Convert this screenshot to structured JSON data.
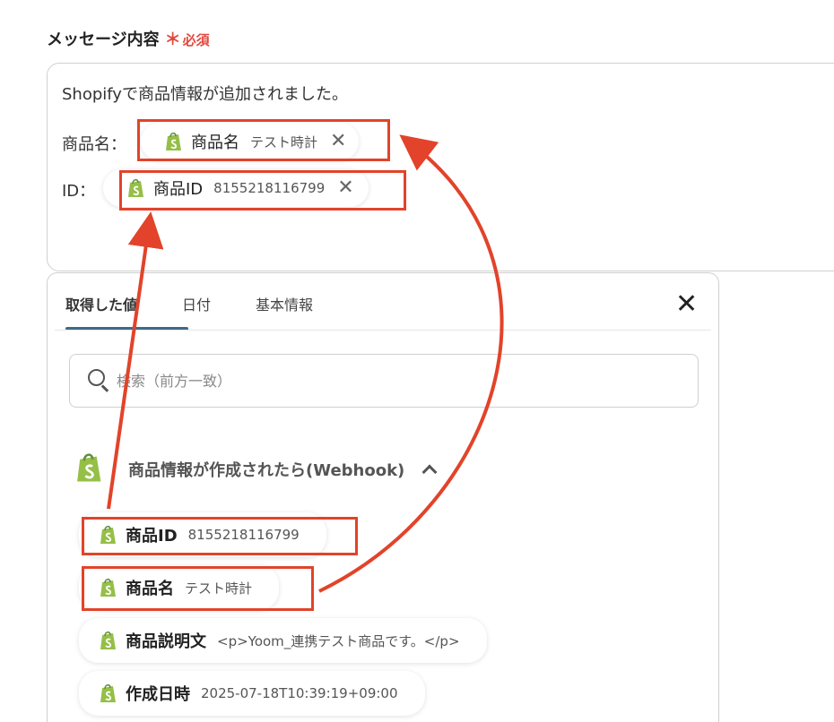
{
  "field": {
    "label": "メッセージ内容",
    "required_star": "＊",
    "required_text": "必須"
  },
  "message": {
    "line1": "Shopifyで商品情報が追加されました。",
    "line2_prefix": "商品名：",
    "line3_prefix": "ID："
  },
  "inserted_chips": [
    {
      "name": "商品名",
      "value": "テスト時計"
    },
    {
      "name": "商品ID",
      "value": "8155218116799"
    }
  ],
  "popup": {
    "tabs": [
      {
        "label": "取得した値",
        "active": true
      },
      {
        "label": "日付",
        "active": false
      },
      {
        "label": "基本情報",
        "active": false
      }
    ],
    "search_placeholder": "検索（前方一致）",
    "group_title": "商品情報が作成されたら(Webhook)",
    "items": [
      {
        "name": "商品ID",
        "value": "8155218116799"
      },
      {
        "name": "商品名",
        "value": "テスト時計"
      },
      {
        "name": "商品説明文",
        "value": "<p>Yoom_連携テスト商品です。</p>"
      },
      {
        "name": "作成日時",
        "value": "2025-07-18T10:39:19+09:00"
      }
    ]
  },
  "colors": {
    "required": "#e2483d",
    "highlight": "#e2432a",
    "tab_underline": "#3e6a8a",
    "shopify_green": "#95bf47"
  },
  "icons": [
    "shopify-icon",
    "close-icon",
    "search-icon",
    "chevron-up-icon"
  ]
}
